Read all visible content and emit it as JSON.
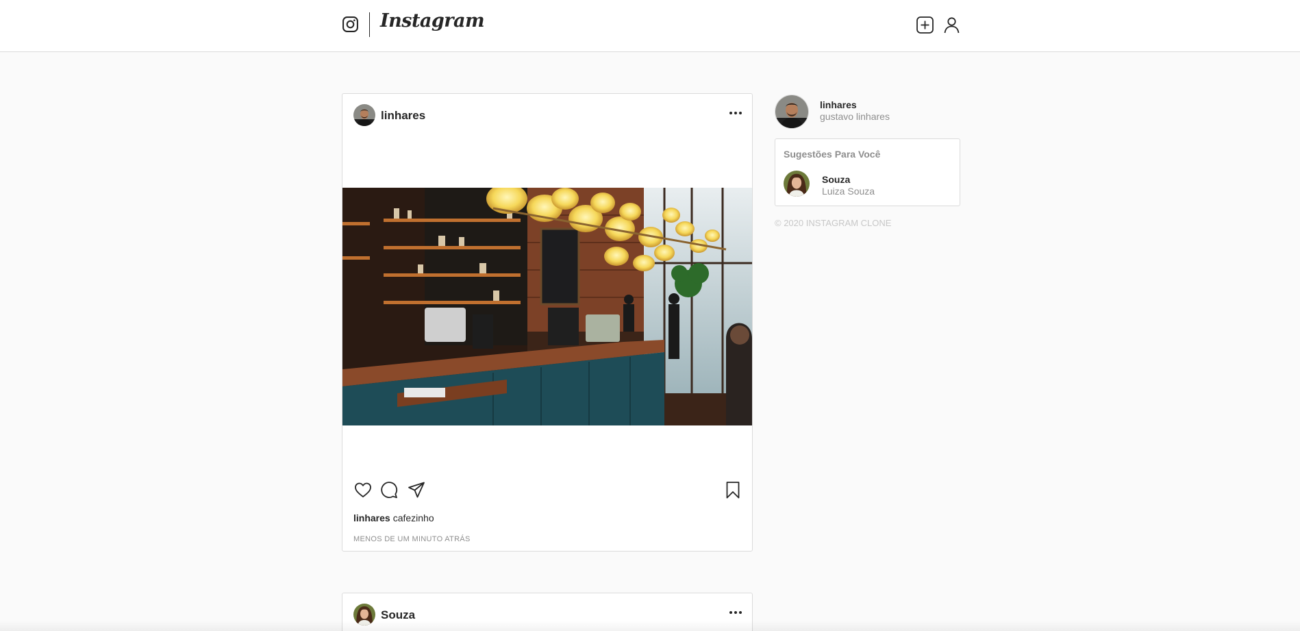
{
  "header": {
    "brand": "Instagram",
    "icons": {
      "logo": "instagram-glyph",
      "new_post": "plus-square-icon",
      "profile": "user-icon"
    }
  },
  "feed": {
    "posts": [
      {
        "username": "linhares",
        "image": "coffee-shop-interior",
        "caption_user": "linhares",
        "caption_text": "cafezinho",
        "timestamp": "MENOS DE UM MINUTO ATRÁS"
      },
      {
        "username": "Souza"
      }
    ]
  },
  "sidebar": {
    "current_user": {
      "username": "linhares",
      "name": "gustavo linhares"
    },
    "suggestions": {
      "title": "Sugestões Para Você",
      "items": [
        {
          "username": "Souza",
          "name": "Luiza Souza"
        }
      ]
    },
    "copyright": "© 2020 INSTAGRAM CLONE"
  },
  "colors": {
    "page_bg": "#fafafa",
    "card_bg": "#ffffff",
    "border": "#dbdbdb",
    "text": "#262626",
    "muted": "#8e8e8e",
    "faint": "#c7c7c7"
  }
}
